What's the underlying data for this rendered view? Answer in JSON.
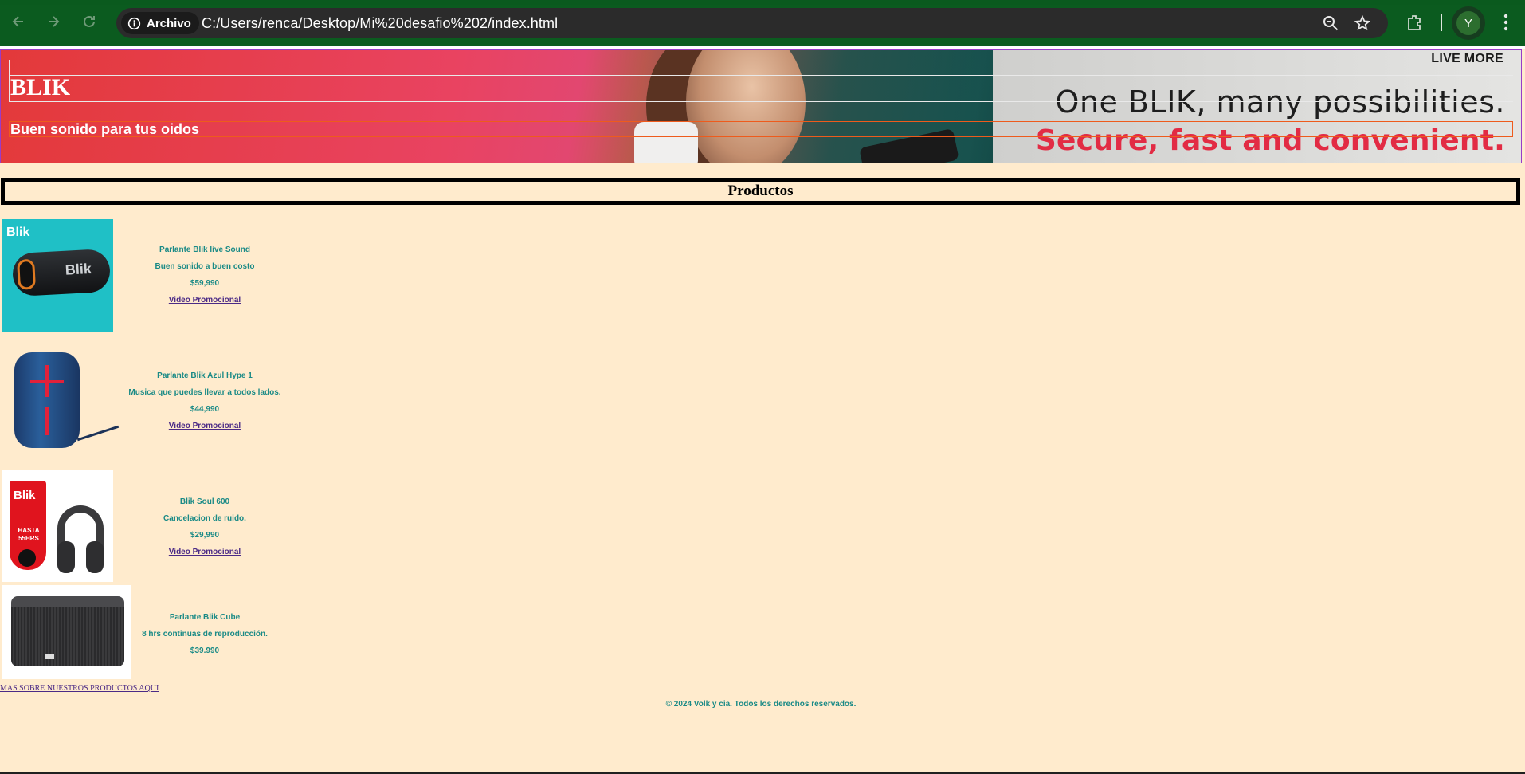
{
  "browser": {
    "site_chip_label": "Archivo",
    "url": "C:/Users/renca/Desktop/Mi%20desafio%202/index.html",
    "profile_initial": "Y"
  },
  "header": {
    "brand": "BLIK",
    "slogan": "Buen sonido para tus oidos",
    "banner": {
      "live_more": "LIVE MORE",
      "tagline_1": "One BLIK, many possibilities.",
      "tagline_2": "Secure, fast and convenient."
    }
  },
  "section": {
    "title": "Productos"
  },
  "products": [
    {
      "name": "Parlante Blik live Sound",
      "description": "Buen sonido a buen costo",
      "price": "$59,990",
      "video_link": "Video Promocional",
      "image_text": "Blik"
    },
    {
      "name": "Parlante Blik Azul Hype 1",
      "description": "Musica que puedes llevar a todos lados.",
      "price": "$44,990",
      "video_link": "Video Promocional"
    },
    {
      "name": "Blik Soul 600",
      "description": "Cancelacion de ruido.",
      "price": "$29,990",
      "video_link": "Video Promocional",
      "image_text": "Blik",
      "image_subtext": "HASTA 55HRS"
    },
    {
      "name": "Parlante Blik Cube",
      "description": "8 hrs continuas de reproducción.",
      "price": "$39.990"
    }
  ],
  "more_link": "MAS SOBRE NUESTROS PRODUCTOS AQUI",
  "footer": {
    "copyright": "© 2024 Volk y cia. Todos los derechos reservados."
  },
  "colors": {
    "page_bg": "#ffebcd",
    "chrome_bg": "#0b5b1f",
    "product_text": "#1a8a86",
    "link": "#4b2a86"
  }
}
